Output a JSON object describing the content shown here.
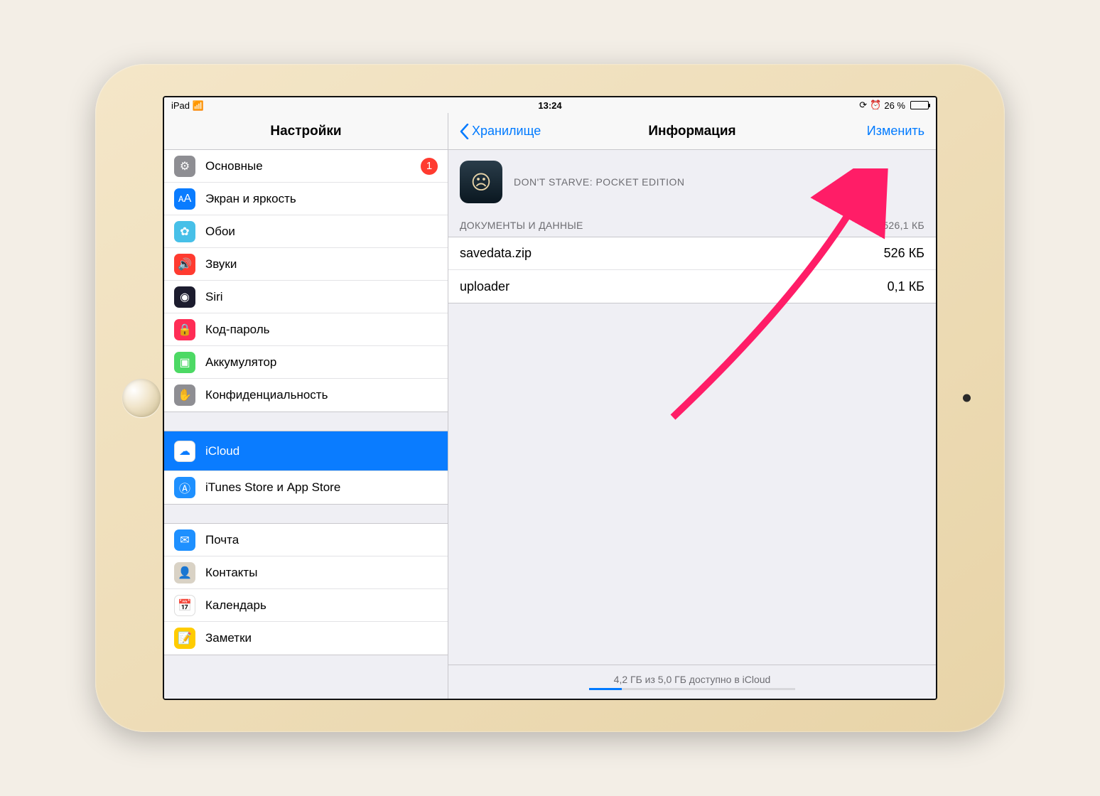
{
  "status": {
    "device": "iPad",
    "time": "13:24",
    "battery": "26 %"
  },
  "sidebar": {
    "title": "Настройки",
    "groups": [
      [
        {
          "label": "Основные",
          "badge": "1",
          "iconColor": "#8e8e93",
          "glyph": "⚙"
        },
        {
          "label": "Экран и яркость",
          "iconColor": "#0a7cff",
          "glyph": "ᴀA"
        },
        {
          "label": "Обои",
          "iconColor": "#47c0e8",
          "glyph": "✿"
        },
        {
          "label": "Звуки",
          "iconColor": "#ff3b30",
          "glyph": "🔊"
        },
        {
          "label": "Siri",
          "iconColor": "#1c1c2e",
          "glyph": "◉"
        },
        {
          "label": "Код-пароль",
          "iconColor": "#ff2d55",
          "glyph": "🔒"
        },
        {
          "label": "Аккумулятор",
          "iconColor": "#4cd964",
          "glyph": "▣"
        },
        {
          "label": "Конфиденциальность",
          "iconColor": "#8e8e93",
          "glyph": "✋"
        }
      ],
      [
        {
          "label": "iCloud",
          "iconColor": "#ffffff",
          "glyph": "☁",
          "selected": true
        },
        {
          "label": "iTunes Store и App Store",
          "iconColor": "#1e90ff",
          "glyph": "Ⓐ"
        }
      ],
      [
        {
          "label": "Почта",
          "iconColor": "#1e90ff",
          "glyph": "✉"
        },
        {
          "label": "Контакты",
          "iconColor": "#d9d2c5",
          "glyph": "👤"
        },
        {
          "label": "Календарь",
          "iconColor": "#ffffff",
          "glyph": "📅"
        },
        {
          "label": "Заметки",
          "iconColor": "#ffcc00",
          "glyph": "📝"
        }
      ]
    ]
  },
  "main": {
    "back": "Хранилище",
    "title": "Информация",
    "action": "Изменить",
    "appName": "DON'T STARVE: POCKET EDITION",
    "sectionHeader": "ДОКУМЕНТЫ И ДАННЫЕ",
    "sectionSize": "526,1 КБ",
    "files": [
      {
        "name": "savedata.zip",
        "size": "526 КБ"
      },
      {
        "name": "uploader",
        "size": "0,1 КБ"
      }
    ],
    "footer": "4,2 ГБ из 5,0 ГБ доступно в iCloud"
  }
}
